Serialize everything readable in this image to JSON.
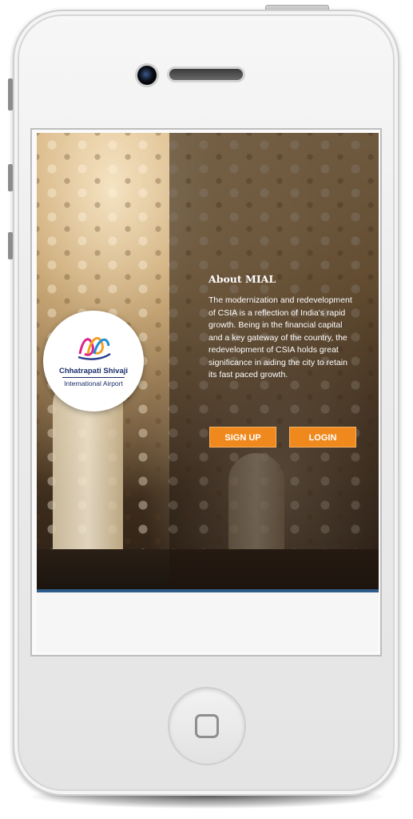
{
  "logo": {
    "line1": "Chhatrapati Shivaji",
    "line2": "International Airport"
  },
  "about": {
    "title": "About MIAL",
    "text": "The modernization and redevelopment of CSIA is a reflection of India's rapid growth. Being in the financial capital and a key gateway of the country, the redevelopment of CSIA holds great significance in aiding the city to retain its fast paced growth."
  },
  "buttons": {
    "signup": "SIGN UP",
    "login": "LOGIN"
  },
  "colors": {
    "accent": "#f0891d",
    "brand_blue": "#2e5c8a"
  },
  "icons": {
    "camera": "camera-icon",
    "home": "home-button-icon",
    "logo": "csia-logo-icon"
  }
}
